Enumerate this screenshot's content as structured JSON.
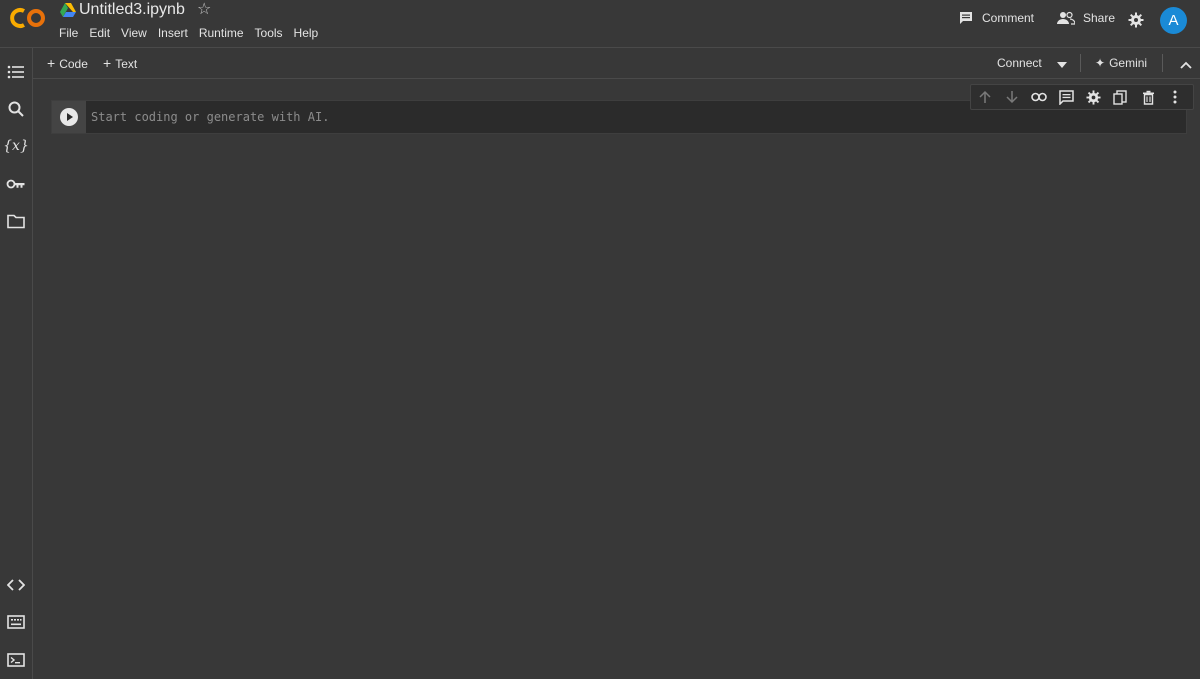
{
  "app": {
    "logo_text": "CO",
    "logo_color": "#f9ab00",
    "notebook_title": "Untitled3.ipynb",
    "star_icon": "star-outline-icon"
  },
  "menu": [
    "File",
    "Edit",
    "View",
    "Insert",
    "Runtime",
    "Tools",
    "Help"
  ],
  "header_actions": {
    "comment_label": "Comment",
    "share_label": "Share",
    "avatar_letter": "A",
    "avatar_color": "#1a8ad6"
  },
  "toolbar": {
    "code_label": "Code",
    "text_label": "Text",
    "connect_label": "Connect",
    "gemini_label": "Gemini"
  },
  "cell": {
    "placeholder": "Start coding or generate with AI."
  },
  "left_sidebar_icons": [
    "table-of-contents-icon",
    "search-icon",
    "variables-icon",
    "secrets-key-icon",
    "files-folder-icon",
    "code-snippets-icon",
    "command-palette-icon",
    "terminal-icon"
  ],
  "cell_toolbar_icons": [
    "move-up-icon",
    "move-down-icon",
    "link-icon",
    "comment-icon",
    "settings-icon",
    "mirror-cell-icon",
    "delete-icon",
    "more-vert-icon"
  ]
}
